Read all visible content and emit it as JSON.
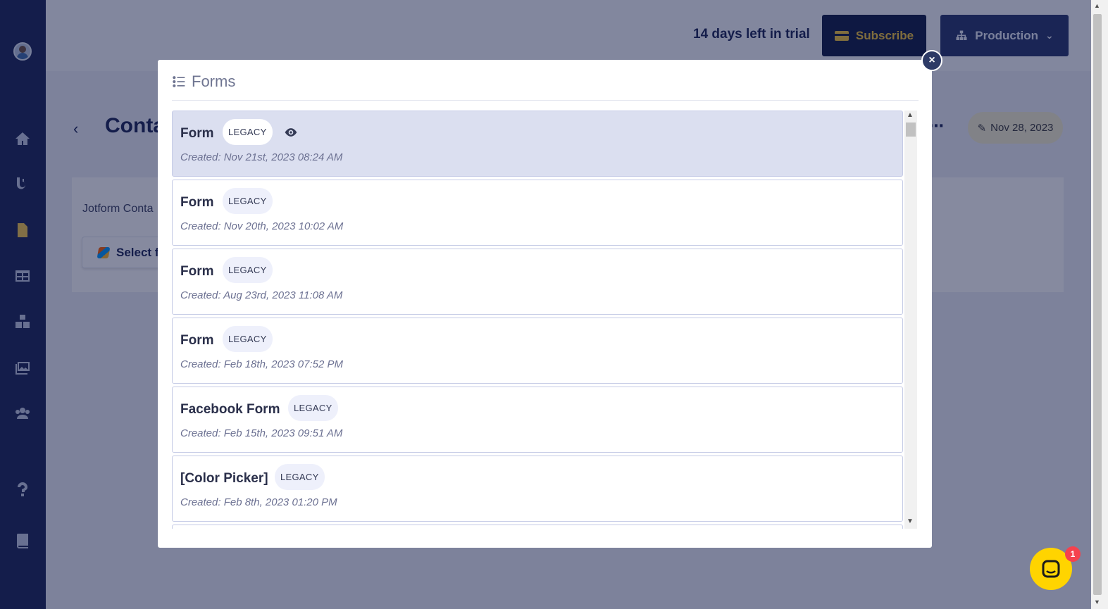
{
  "header": {
    "trial_text": "14 days left in trial",
    "subscribe_label": "Subscribe",
    "environment_label": "Production"
  },
  "page": {
    "title": "Conta",
    "date_label": "Nov 28, 2023",
    "jotform_label": "Jotform Conta",
    "select_label": "Select f"
  },
  "modal": {
    "title": "Forms",
    "close_symbol": "×",
    "forms": [
      {
        "name": "Form",
        "badge": "LEGACY",
        "created": "Created: Nov 21st, 2023 08:24 AM",
        "selected": true
      },
      {
        "name": "Form",
        "badge": "LEGACY",
        "created": "Created: Nov 20th, 2023 10:02 AM"
      },
      {
        "name": "Form",
        "badge": "LEGACY",
        "created": "Created: Aug 23rd, 2023 11:08 AM"
      },
      {
        "name": "Form",
        "badge": "LEGACY",
        "created": "Created: Feb 18th, 2023 07:52 PM"
      },
      {
        "name": "Facebook Form",
        "badge": "LEGACY",
        "created": "Created: Feb 15th, 2023 09:51 AM"
      },
      {
        "name": "[Color Picker]",
        "badge": "LEGACY",
        "created": "Created: Feb 8th, 2023 01:20 PM"
      }
    ]
  },
  "chat": {
    "badge_count": "1"
  },
  "colors": {
    "sidebar": "#1b2556",
    "subscribe_bg": "#0e1a44",
    "subscribe_text": "#f2c43b",
    "selected_row": "#dbdff0",
    "chat": "#ffd400",
    "badge": "#f5424e"
  },
  "icons": {
    "sidebar": [
      "home-icon",
      "flow-icon",
      "document-icon",
      "table-icon",
      "boxes-icon",
      "gallery-icon",
      "users-icon",
      "help-icon",
      "book-icon"
    ],
    "modal_header": "list-icon",
    "selected_row": "eye-icon"
  }
}
